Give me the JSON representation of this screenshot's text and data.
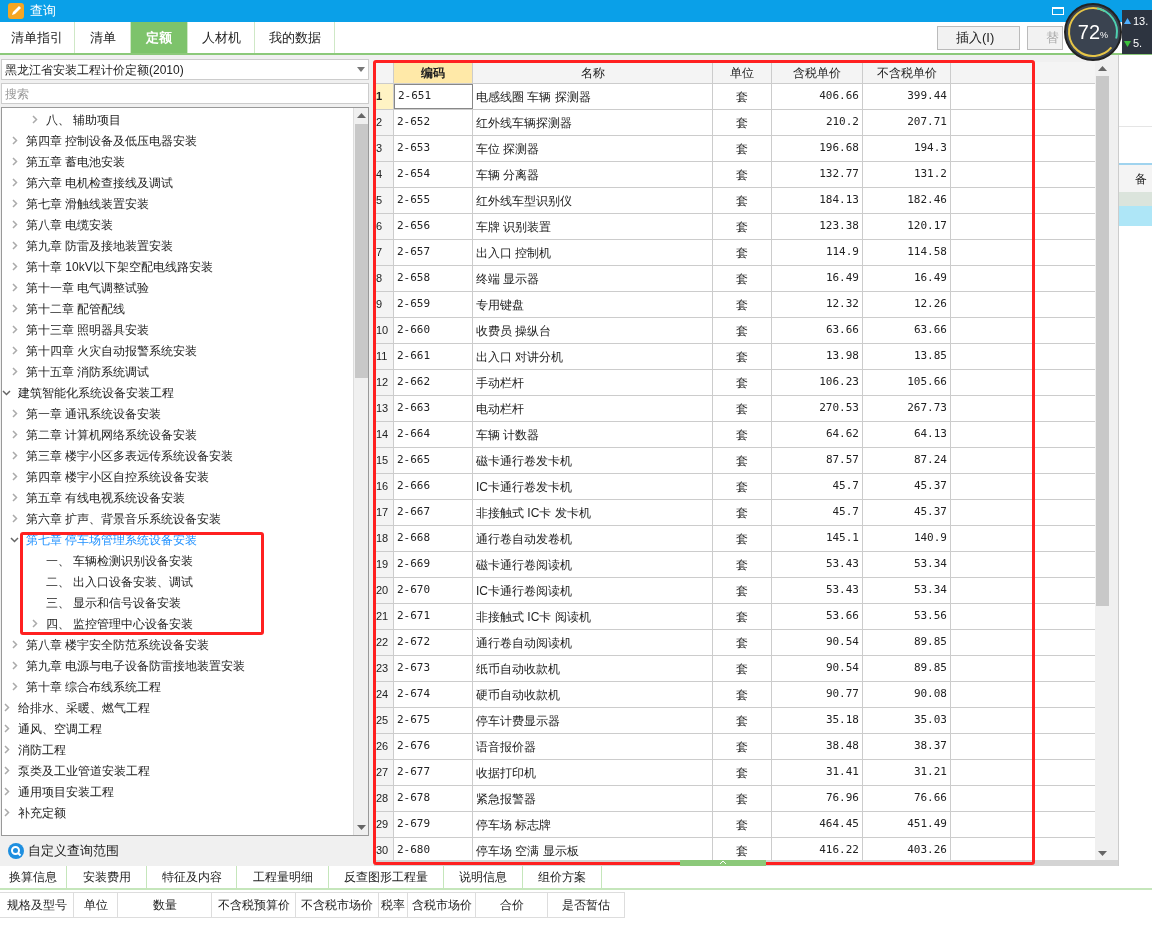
{
  "window": {
    "title": "查询"
  },
  "tabs": [
    {
      "label": "清单指引",
      "selected": false
    },
    {
      "label": "清单",
      "selected": false
    },
    {
      "label": "定额",
      "selected": true
    },
    {
      "label": "人材机",
      "selected": false
    },
    {
      "label": "我的数据",
      "selected": false
    }
  ],
  "toolbar": {
    "buttons": [
      "插入(I)",
      "替"
    ]
  },
  "widget": {
    "percent": "72",
    "unit": "%",
    "upload": "13.",
    "download": "5."
  },
  "library": {
    "value": "黑龙江省安装工程计价定额(2010)"
  },
  "search": {
    "placeholder": "搜索"
  },
  "tree": [
    {
      "children": [
        {
          "children": [
            {
              "label": "八、 辅助项目",
              "expanded": false,
              "selected": false
            }
          ]
        },
        {
          "label": "第四章 控制设备及低压电器安装",
          "expanded": false,
          "selected": false
        },
        {
          "label": "第五章 蓄电池安装",
          "expanded": false,
          "selected": false
        },
        {
          "label": "第六章 电机检查接线及调试",
          "expanded": false,
          "selected": false
        },
        {
          "label": "第七章 滑触线装置安装",
          "expanded": false,
          "selected": false
        },
        {
          "label": "第八章 电缆安装",
          "expanded": false,
          "selected": false
        },
        {
          "label": "第九章 防雷及接地装置安装",
          "expanded": false,
          "selected": false
        },
        {
          "label": "第十章 10kV以下架空配电线路安装",
          "expanded": false,
          "selected": false
        },
        {
          "label": "第十一章 电气调整试验",
          "expanded": false,
          "selected": false
        },
        {
          "label": "第十二章 配管配线",
          "expanded": false,
          "selected": false
        },
        {
          "label": "第十三章 照明器具安装",
          "expanded": false,
          "selected": false
        },
        {
          "label": "第十四章 火灾自动报警系统安装",
          "expanded": false,
          "selected": false
        },
        {
          "label": "第十五章 消防系统调试",
          "expanded": false,
          "selected": false
        }
      ]
    },
    {
      "label": "建筑智能化系统设备安装工程",
      "expanded": true,
      "selected": false,
      "children": [
        {
          "label": "第一章 通讯系统设备安装",
          "expanded": false,
          "selected": false
        },
        {
          "label": "第二章 计算机网络系统设备安装",
          "expanded": false,
          "selected": false
        },
        {
          "label": "第三章 楼宇小区多表远传系统设备安装",
          "expanded": false,
          "selected": false
        },
        {
          "label": "第四章 楼宇小区自控系统设备安装",
          "expanded": false,
          "selected": false
        },
        {
          "label": "第五章 有线电视系统设备安装",
          "expanded": false,
          "selected": false
        },
        {
          "label": "第六章 扩声、背景音乐系统设备安装",
          "expanded": false,
          "selected": false
        },
        {
          "label": "第七章 停车场管理系统设备安装",
          "expanded": true,
          "selected": true,
          "children": [
            {
              "label": "一、 车辆检测识别设备安装",
              "selected": false
            },
            {
              "label": "二、 出入口设备安装、调试",
              "selected": false
            },
            {
              "label": "三、 显示和信号设备安装",
              "selected": false
            },
            {
              "label": "四、 监控管理中心设备安装",
              "expanded": false,
              "selected": false
            }
          ]
        },
        {
          "label": "第八章 楼宇安全防范系统设备安装",
          "expanded": false,
          "selected": false
        },
        {
          "label": "第九章 电源与电子设备防雷接地装置安装",
          "expanded": false,
          "selected": false
        },
        {
          "label": "第十章 综合布线系统工程",
          "expanded": false,
          "selected": false
        }
      ]
    },
    {
      "label": "给排水、采暖、燃气工程",
      "expanded": false,
      "selected": false
    },
    {
      "label": "通风、空调工程",
      "expanded": false,
      "selected": false
    },
    {
      "label": "消防工程",
      "expanded": false,
      "selected": false
    },
    {
      "label": "泵类及工业管道安装工程",
      "expanded": false,
      "selected": false
    },
    {
      "label": "通用项目安装工程",
      "expanded": false,
      "selected": false
    },
    {
      "label": "补充定额",
      "expanded": false,
      "selected": false
    }
  ],
  "custom_scope": "自定义查询范围",
  "table": {
    "columns": [
      {
        "label": "编码",
        "selected": true
      },
      {
        "label": "名称",
        "selected": false
      },
      {
        "label": "单位",
        "selected": false
      },
      {
        "label": "含税单价",
        "selected": false
      },
      {
        "label": "不含税单价",
        "selected": false
      }
    ],
    "rows": [
      {
        "n": "1",
        "selected": true,
        "cells": [
          "2-651",
          "电感线圈 车辆 探测器",
          "套",
          "406.66",
          "399.44"
        ]
      },
      {
        "n": "2",
        "selected": false,
        "cells": [
          "2-652",
          "红外线车辆探测器",
          "套",
          "210.2",
          "207.71"
        ]
      },
      {
        "n": "3",
        "selected": false,
        "cells": [
          "2-653",
          "车位 探测器",
          "套",
          "196.68",
          "194.3"
        ]
      },
      {
        "n": "4",
        "selected": false,
        "cells": [
          "2-654",
          "车辆 分离器",
          "套",
          "132.77",
          "131.2"
        ]
      },
      {
        "n": "5",
        "selected": false,
        "cells": [
          "2-655",
          "红外线车型识别仪",
          "套",
          "184.13",
          "182.46"
        ]
      },
      {
        "n": "6",
        "selected": false,
        "cells": [
          "2-656",
          "车牌 识别装置",
          "套",
          "123.38",
          "120.17"
        ]
      },
      {
        "n": "7",
        "selected": false,
        "cells": [
          "2-657",
          "出入口 控制机",
          "套",
          "114.9",
          "114.58"
        ]
      },
      {
        "n": "8",
        "selected": false,
        "cells": [
          "2-658",
          "终端 显示器",
          "套",
          "16.49",
          "16.49"
        ]
      },
      {
        "n": "9",
        "selected": false,
        "cells": [
          "2-659",
          "专用键盘",
          "套",
          "12.32",
          "12.26"
        ]
      },
      {
        "n": "10",
        "selected": false,
        "cells": [
          "2-660",
          "收费员 操纵台",
          "套",
          "63.66",
          "63.66"
        ]
      },
      {
        "n": "11",
        "selected": false,
        "cells": [
          "2-661",
          "出入口 对讲分机",
          "套",
          "13.98",
          "13.85"
        ]
      },
      {
        "n": "12",
        "selected": false,
        "cells": [
          "2-662",
          "手动栏杆",
          "套",
          "106.23",
          "105.66"
        ]
      },
      {
        "n": "13",
        "selected": false,
        "cells": [
          "2-663",
          "电动栏杆",
          "套",
          "270.53",
          "267.73"
        ]
      },
      {
        "n": "14",
        "selected": false,
        "cells": [
          "2-664",
          "车辆 计数器",
          "套",
          "64.62",
          "64.13"
        ]
      },
      {
        "n": "15",
        "selected": false,
        "cells": [
          "2-665",
          "磁卡通行卷发卡机",
          "套",
          "87.57",
          "87.24"
        ]
      },
      {
        "n": "16",
        "selected": false,
        "cells": [
          "2-666",
          "IC卡通行卷发卡机",
          "套",
          "45.7",
          "45.37"
        ]
      },
      {
        "n": "17",
        "selected": false,
        "cells": [
          "2-667",
          "非接触式 IC卡 发卡机",
          "套",
          "45.7",
          "45.37"
        ]
      },
      {
        "n": "18",
        "selected": false,
        "cells": [
          "2-668",
          "通行卷自动发卷机",
          "套",
          "145.1",
          "140.9"
        ]
      },
      {
        "n": "19",
        "selected": false,
        "cells": [
          "2-669",
          "磁卡通行卷阅读机",
          "套",
          "53.43",
          "53.34"
        ]
      },
      {
        "n": "20",
        "selected": false,
        "cells": [
          "2-670",
          "IC卡通行卷阅读机",
          "套",
          "53.43",
          "53.34"
        ]
      },
      {
        "n": "21",
        "selected": false,
        "cells": [
          "2-671",
          "非接触式 IC卡 阅读机",
          "套",
          "53.66",
          "53.56"
        ]
      },
      {
        "n": "22",
        "selected": false,
        "cells": [
          "2-672",
          "通行卷自动阅读机",
          "套",
          "90.54",
          "89.85"
        ]
      },
      {
        "n": "23",
        "selected": false,
        "cells": [
          "2-673",
          "纸币自动收款机",
          "套",
          "90.54",
          "89.85"
        ]
      },
      {
        "n": "24",
        "selected": false,
        "cells": [
          "2-674",
          "硬币自动收款机",
          "套",
          "90.77",
          "90.08"
        ]
      },
      {
        "n": "25",
        "selected": false,
        "cells": [
          "2-675",
          "停车计费显示器",
          "套",
          "35.18",
          "35.03"
        ]
      },
      {
        "n": "26",
        "selected": false,
        "cells": [
          "2-676",
          "语音报价器",
          "套",
          "38.48",
          "38.37"
        ]
      },
      {
        "n": "27",
        "selected": false,
        "cells": [
          "2-677",
          "收据打印机",
          "套",
          "31.41",
          "31.21"
        ]
      },
      {
        "n": "28",
        "selected": false,
        "cells": [
          "2-678",
          "紧急报警器",
          "套",
          "76.96",
          "76.66"
        ]
      },
      {
        "n": "29",
        "selected": false,
        "cells": [
          "2-679",
          "停车场 标志牌",
          "套",
          "464.45",
          "451.49"
        ]
      },
      {
        "n": "30",
        "selected": false,
        "cells": [
          "2-680",
          "停车场 空满 显示板",
          "套",
          "416.22",
          "403.26"
        ]
      }
    ]
  },
  "side_panel": {
    "column": "备"
  },
  "bottom_tabs": [
    "换算信息",
    "安装费用",
    "特征及内容",
    "工程量明细",
    "反查图形工程量",
    "说明信息",
    "组价方案"
  ],
  "bottom_columns": [
    "规格及型号",
    "单位",
    "数量",
    "不含税预算价",
    "不含税市场价",
    "税率",
    "含税市场价",
    "合价",
    "是否暂估"
  ]
}
